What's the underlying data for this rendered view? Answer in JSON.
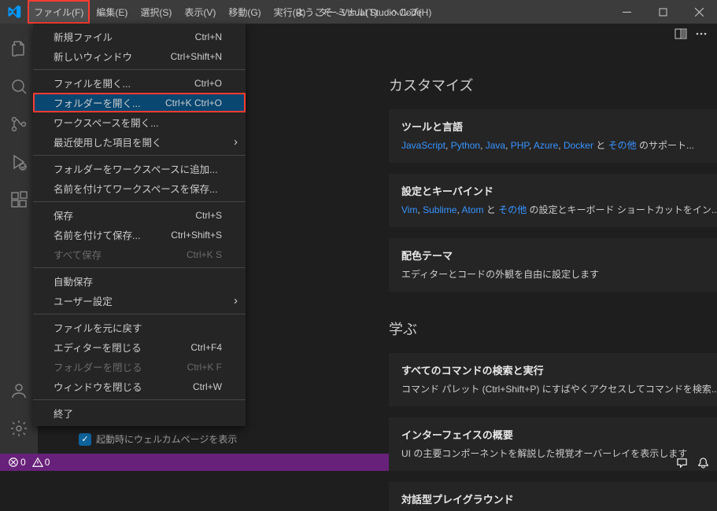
{
  "window": {
    "title": "ようこそ - Visual Studio Code"
  },
  "menubar": {
    "file": "ファイル(F)",
    "edit": "編集(E)",
    "select": "選択(S)",
    "view": "表示(V)",
    "go": "移動(G)",
    "run": "実行(R)",
    "terminal": "ターミナル(T)",
    "help": "ヘルプ(H)"
  },
  "fileMenu": {
    "newFile": {
      "label": "新規ファイル",
      "shortcut": "Ctrl+N"
    },
    "newWindow": {
      "label": "新しいウィンドウ",
      "shortcut": "Ctrl+Shift+N"
    },
    "openFile": {
      "label": "ファイルを開く...",
      "shortcut": "Ctrl+O"
    },
    "openFolder": {
      "label": "フォルダーを開く...",
      "shortcut": "Ctrl+K Ctrl+O"
    },
    "openWorkspace": {
      "label": "ワークスペースを開く..."
    },
    "openRecent": {
      "label": "最近使用した項目を開く"
    },
    "addFolderToWs": {
      "label": "フォルダーをワークスペースに追加..."
    },
    "saveWsAs": {
      "label": "名前を付けてワークスペースを保存..."
    },
    "save": {
      "label": "保存",
      "shortcut": "Ctrl+S"
    },
    "saveAs": {
      "label": "名前を付けて保存...",
      "shortcut": "Ctrl+Shift+S"
    },
    "saveAll": {
      "label": "すべて保存",
      "shortcut": "Ctrl+K S"
    },
    "autoSave": {
      "label": "自動保存"
    },
    "preferences": {
      "label": "ユーザー設定"
    },
    "revert": {
      "label": "ファイルを元に戻す"
    },
    "closeEditor": {
      "label": "エディターを閉じる",
      "shortcut": "Ctrl+F4"
    },
    "closeFolder": {
      "label": "フォルダーを閉じる",
      "shortcut": "Ctrl+K F"
    },
    "closeWindow": {
      "label": "ウィンドウを閉じる",
      "shortcut": "Ctrl+W"
    },
    "exit": {
      "label": "終了"
    }
  },
  "welcome": {
    "customize": {
      "title": "カスタマイズ",
      "tools": {
        "title": "ツールと言語",
        "links": [
          "JavaScript",
          "Python",
          "Java",
          "PHP",
          "Azure",
          "Docker"
        ],
        "between": ", ",
        "after1": " と ",
        "moreLink": "その他",
        "after2": " のサポート..."
      },
      "settings": {
        "title": "設定とキーバインド",
        "links": [
          "Vim",
          "Sublime",
          "Atom"
        ],
        "after1": " と ",
        "moreLink": "その他",
        "after2": " の設定とキーボード ショートカットをイン..."
      },
      "colorTheme": {
        "title": "配色テーマ",
        "text": "エディターとコードの外観を自由に設定します"
      }
    },
    "learn": {
      "title": "学ぶ",
      "commands": {
        "title": "すべてのコマンドの検索と実行",
        "text": "コマンド パレット (Ctrl+Shift+P) にすばやくアクセスしてコマンドを検索..."
      },
      "ui": {
        "title": "インターフェイスの概要",
        "text": "UI の主要コンポーネントを解説した視覚オーバーレイを表示します"
      },
      "playground": {
        "title": "対話型プレイグラウンド"
      }
    },
    "startupCheckbox": "起動時にウェルカムページを表示"
  },
  "statusbar": {
    "errors": "0",
    "warnings": "0"
  }
}
